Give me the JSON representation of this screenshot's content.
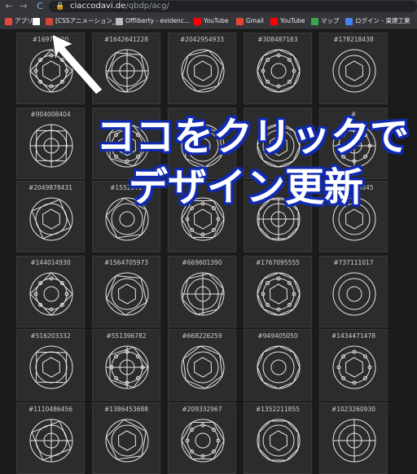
{
  "browser": {
    "url_host": "ciaccodavi.de",
    "url_path": "/qbdp/acg/",
    "nav": {
      "back": "←",
      "forward": "→",
      "reload": "C"
    },
    "lock": "🔒"
  },
  "bookmarks": [
    {
      "label": "アプリ",
      "color": "#e8453c"
    },
    {
      "label": "",
      "color": "#ffffff"
    },
    {
      "label": "[CSSアニメーション_",
      "color": "#d14836"
    },
    {
      "label": "Offliberty - evidenc...",
      "color": "#bdbdbd"
    },
    {
      "label": "YouTube",
      "color": "#ff0000"
    },
    {
      "label": "Gmail",
      "color": "#ea4335"
    },
    {
      "label": "YouTube",
      "color": "#ff0000"
    },
    {
      "label": "マップ",
      "color": "#34a853"
    },
    {
      "label": "ログイン - 東建工業",
      "color": "#4285f4"
    }
  ],
  "cards": [
    [
      "#16973590",
      "#1642641228",
      "#2042954933",
      "#308487163",
      "#178218438"
    ],
    [
      "#904008404",
      "",
      "",
      "",
      "#"
    ],
    [
      "#2049878431",
      "#1552972",
      "",
      "",
      "#497840345"
    ],
    [
      "#144014930",
      "#1564705973",
      "#669601390",
      "#1767095555",
      "#737111017"
    ],
    [
      "#516203332",
      "#551396782",
      "#668226259",
      "#949405050",
      "#1434471478"
    ],
    [
      "#1110486456",
      "#1386453688",
      "#209332967",
      "#1352211855",
      "#1023260930"
    ]
  ],
  "overlay": {
    "line1": "ココをクリックで",
    "line2": "デザイン更新"
  },
  "colors": {
    "overlay_outline": "#102ab0",
    "card_bg": "#2c2c2c",
    "page_bg": "#1b1b1b"
  }
}
